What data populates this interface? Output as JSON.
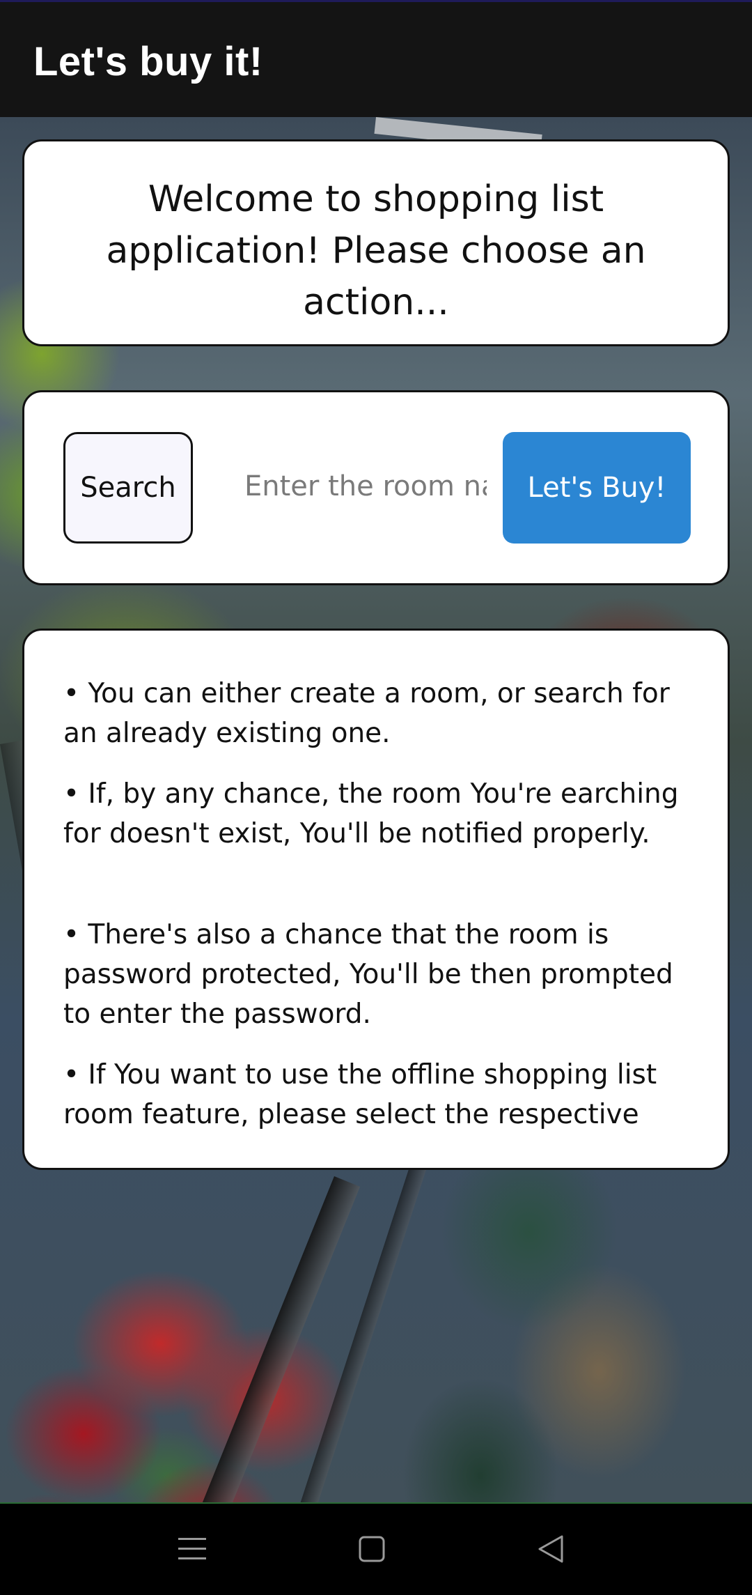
{
  "app": {
    "title": "Let's buy it!"
  },
  "welcome": {
    "text": "Welcome to shopping list application! Please choose an action..."
  },
  "search": {
    "button_label": "Search",
    "input_placeholder": "Enter the room name",
    "input_value": "",
    "buy_button_label": "Let's Buy!"
  },
  "info": {
    "items": [
      "• You can either create a room, or search for an already existing one.",
      "• If, by any chance, the room You're earching for doesn't exist, You'll be notified properly.",
      "• There's also a chance that the room is password protected, You'll be then prompted to enter the password.",
      "• If You want to use the offline shopping list room feature, please select the respective"
    ]
  },
  "navigation": {
    "icons": [
      "menu-icon",
      "home-square-icon",
      "back-triangle-icon"
    ]
  },
  "colors": {
    "app_bar": "#141414",
    "primary_button": "#2b86d3",
    "card_background": "#ffffff",
    "search_button_background": "#f7f6fd"
  }
}
